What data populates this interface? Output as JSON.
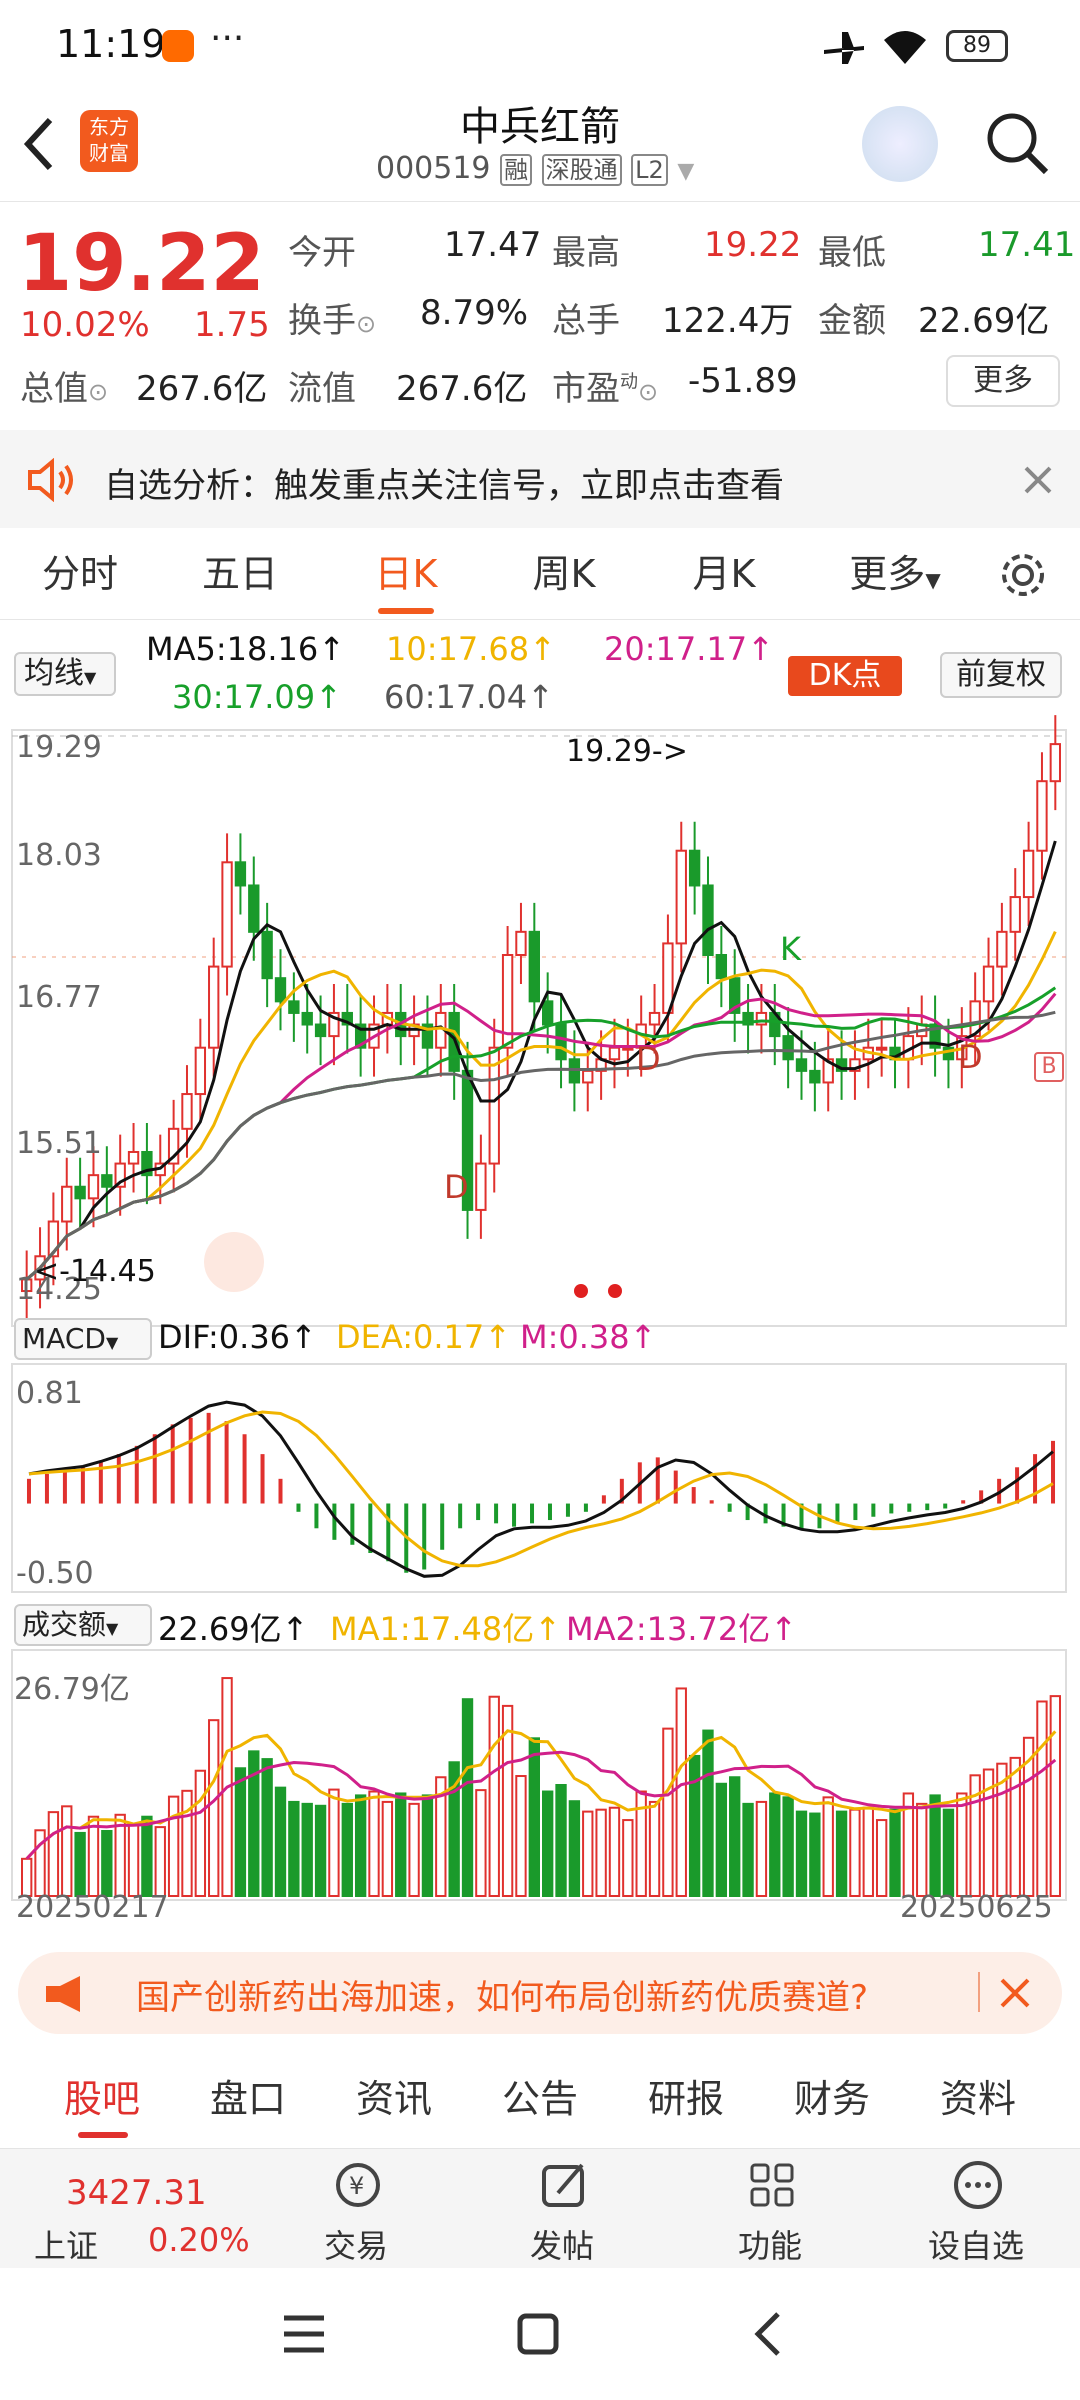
{
  "status": {
    "time": "11:19",
    "battery": "89"
  },
  "header": {
    "title": "中兵红箭",
    "code": "000519",
    "tag1": "融",
    "tag2": "深股通",
    "tag3": "L2",
    "logo_line1": "东方",
    "logo_line2": "财富"
  },
  "quote": {
    "price": "19.22",
    "pct": "10.02%",
    "chg": "1.75",
    "open_label": "今开",
    "open": "17.47",
    "high_label": "最高",
    "high": "19.22",
    "low_label": "最低",
    "low": "17.41",
    "turn_label": "换手",
    "turn": "8.79%",
    "vol_label": "总手",
    "vol": "122.4万",
    "amt_label": "金额",
    "amt": "22.69亿",
    "mcap_label": "总值",
    "mcap": "267.6亿",
    "float_label": "流值",
    "float": "267.6亿",
    "pe_label": "市盈",
    "pe_sup": "动",
    "pe": "-51.89",
    "more": "更多"
  },
  "tip": {
    "text": "自选分析：触发重点关注信号，立即点击查看"
  },
  "tabs": [
    "分时",
    "五日",
    "日K",
    "周K",
    "月K",
    "更多"
  ],
  "active_tab": "日K",
  "ma_bar": {
    "btn": "均线",
    "ma5": "MA5:18.16↑",
    "ma10": "10:17.68↑",
    "ma20": "20:17.17↑",
    "ma30": "30:17.09↑",
    "ma60": "60:17.04↑",
    "dk": "DK点",
    "fq": "前复权"
  },
  "kchart": {
    "y1": "19.29",
    "y2": "18.03",
    "y3": "16.77",
    "y4": "15.51",
    "y5": "14.25",
    "max_ann": "19.29->",
    "min_ann": "<-14.45",
    "sig_d": "D",
    "sig_k": "K",
    "sig_b": "B"
  },
  "macd": {
    "btn": "MACD",
    "dif": "DIF:0.36↑",
    "dea": "DEA:0.17↑",
    "m": "M:0.38↑",
    "ymax": "0.81",
    "ymin": "-0.50"
  },
  "volume": {
    "btn": "成交额",
    "val": "22.69亿↑",
    "ma1": "MA1:17.48亿↑",
    "ma2": "MA2:13.72亿↑",
    "ymax": "26.79亿",
    "date_start": "20250217",
    "date_end": "20250625"
  },
  "promo": {
    "text": "国产创新药出海加速，如何布局创新药优质赛道?"
  },
  "subtabs": [
    "股吧",
    "盘口",
    "资讯",
    "公告",
    "研报",
    "财务",
    "资料"
  ],
  "bottombar": {
    "index_val": "3427.31",
    "index_name": "上证",
    "index_pct": "0.20%",
    "trade": "交易",
    "post": "发帖",
    "func": "功能",
    "watch": "设自选"
  },
  "colors": {
    "up": "#e0312e",
    "down": "#1a9a2b",
    "accent": "#f25a1e",
    "ma5": "#111111",
    "ma10": "#f0b400",
    "ma20": "#d0208a",
    "ma30": "#17a02a",
    "ma60": "#666666"
  },
  "chart_data": [
    {
      "type": "candlestick",
      "title": "日K",
      "ylim": [
        14.25,
        19.29
      ],
      "x_start": "20250217",
      "x_end": "20250625",
      "annotations": [
        "19.29->",
        "<-14.45"
      ],
      "close": [
        14.6,
        14.8,
        15.1,
        15.4,
        15.3,
        15.5,
        15.4,
        15.6,
        15.7,
        15.5,
        15.6,
        15.9,
        16.2,
        16.6,
        17.3,
        18.2,
        18.0,
        17.6,
        17.2,
        17.0,
        16.9,
        16.8,
        16.7,
        16.9,
        16.8,
        16.6,
        16.8,
        16.9,
        16.7,
        16.8,
        16.6,
        16.9,
        16.4,
        15.2,
        15.6,
        16.6,
        17.4,
        17.6,
        17.0,
        16.8,
        16.5,
        16.3,
        16.4,
        16.5,
        16.6,
        16.6,
        16.8,
        16.9,
        17.5,
        18.3,
        18.0,
        17.4,
        17.2,
        16.9,
        16.8,
        16.9,
        16.7,
        16.5,
        16.4,
        16.3,
        16.5,
        16.4,
        16.5,
        16.6,
        16.6,
        16.5,
        16.7,
        16.8,
        16.6,
        16.5,
        16.7,
        17.0,
        17.3,
        17.6,
        17.9,
        18.3,
        18.9,
        19.22
      ],
      "ma5": [
        14.4,
        14.6,
        14.8,
        15.0,
        15.2,
        15.3,
        15.4,
        15.5,
        15.5,
        15.5,
        15.6,
        15.8,
        16.1,
        16.4,
        16.9,
        17.5,
        17.8,
        17.7,
        17.4,
        17.1,
        16.9,
        16.8,
        16.8,
        16.8,
        16.7,
        16.7,
        16.7,
        16.7,
        16.6,
        16.6,
        16.5,
        16.3,
        16.0,
        15.9,
        16.3,
        16.8,
        17.1,
        17.1,
        16.9,
        16.7,
        16.5,
        16.4,
        16.4,
        16.5,
        16.7,
        16.9,
        17.3,
        17.6,
        17.7,
        17.6,
        17.4,
        17.1,
        16.9,
        16.8,
        16.7,
        16.6,
        16.5,
        16.4,
        16.4,
        16.4,
        16.4,
        16.5,
        16.5,
        16.5,
        16.6,
        16.6,
        16.6,
        16.6,
        16.7,
        16.8,
        17.0,
        17.3,
        17.6,
        17.9,
        18.16
      ],
      "ma60_end": 17.04
    },
    {
      "type": "bar",
      "title": "MACD",
      "ylim": [
        -0.5,
        0.81
      ],
      "series": [
        {
          "name": "M",
          "values": [
            0.15,
            0.18,
            0.2,
            0.22,
            0.25,
            0.3,
            0.35,
            0.42,
            0.48,
            0.52,
            0.55,
            0.5,
            0.42,
            0.3,
            0.15,
            -0.05,
            -0.15,
            -0.22,
            -0.25,
            -0.3,
            -0.35,
            -0.42,
            -0.4,
            -0.28,
            -0.15,
            -0.1,
            -0.12,
            -0.14,
            -0.12,
            -0.1,
            -0.08,
            -0.05,
            0.05,
            0.15,
            0.25,
            0.28,
            0.2,
            0.1,
            0.02,
            -0.05,
            -0.1,
            -0.12,
            -0.14,
            -0.16,
            -0.15,
            -0.12,
            -0.1,
            -0.08,
            -0.06,
            -0.05,
            -0.04,
            -0.03,
            0.02,
            0.08,
            0.15,
            0.22,
            0.3,
            0.38
          ]
        }
      ]
    },
    {
      "type": "bar",
      "title": "成交额",
      "ylim": [
        0,
        26.79
      ],
      "unit": "亿",
      "last": 22.69,
      "ma1": 17.48,
      "ma2": 13.72
    }
  ]
}
